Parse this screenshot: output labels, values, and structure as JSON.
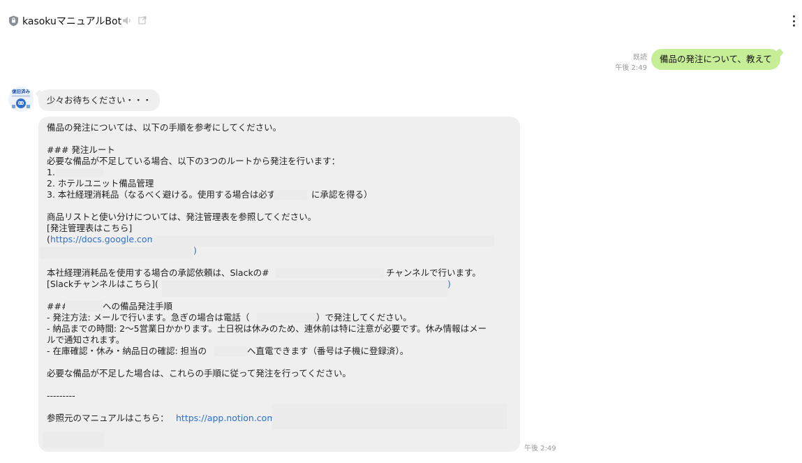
{
  "header": {
    "title": "kasokuマニュアルBot",
    "icons": {
      "shield": "shield-icon",
      "mute": "speaker-muted-icon",
      "external": "external-link-icon",
      "menu": "more-vertical-icon"
    }
  },
  "user_message": {
    "read_label": "既読",
    "time": "午後 2:49",
    "text": "備品の発注について、教えて"
  },
  "bot": {
    "avatar_label": "復旧済み",
    "waiting_text": "少々お待ちください・・・",
    "time": "午後 2:49",
    "lines": {
      "intro": "備品の発注については、以下の手順を参考にしてください。",
      "route_heading": "### 発注ルート",
      "route_desc": "必要な備品が不足している場合、以下の3つのルートから発注を行います：",
      "route_1": "1.",
      "route_2": "2. ホテルユニット備品管理",
      "route_3a": "3. 本社経理消耗品（なるべく避ける。使用する場合は必ず",
      "route_3b": "に承認を得る）",
      "list_desc": "商品リストと使い分けについては、発注管理表を参照してください。",
      "sheet_label": "[発注管理表はこちら]",
      "sheet_open": "(",
      "sheet_link": "https://docs.google.com",
      "sheet_close": ")",
      "slack_a": "本社経理消耗品を使用する場合の承認依頼は、Slackの#",
      "slack_b": "チャンネルで行います。",
      "slack_label": "[Slackチャンネルはこちら](",
      "slack_close": ")",
      "proc_a": "###",
      "proc_b": "への備品発注手順",
      "proc_1a": "- 発注方法: メールで行います。急ぎの場合は電話（",
      "proc_1b": "）で発注してください。",
      "proc_2": "- 納品までの時間: 2〜5営業日かかります。土日祝は休みのため、連休前は特に注意が必要です。休み情報はメー",
      "proc_2b": "ルで通知されます。",
      "proc_3a": "- 在庫確認・休み・納品日の確認: 担当の",
      "proc_3b": "へ直電できます（番号は子機に登録済）。",
      "closing": "必要な備品が不足した場合は、これらの手順に従って発注を行ってください。",
      "divider": "---------",
      "ref_label": "参照元のマニュアルはこちら：",
      "ref_link": "https://app.notion.com/"
    }
  },
  "colors": {
    "user_bubble": "#c6ee96",
    "bot_bubble": "#efefef",
    "link": "#2f6fd0",
    "meta": "#999999"
  }
}
